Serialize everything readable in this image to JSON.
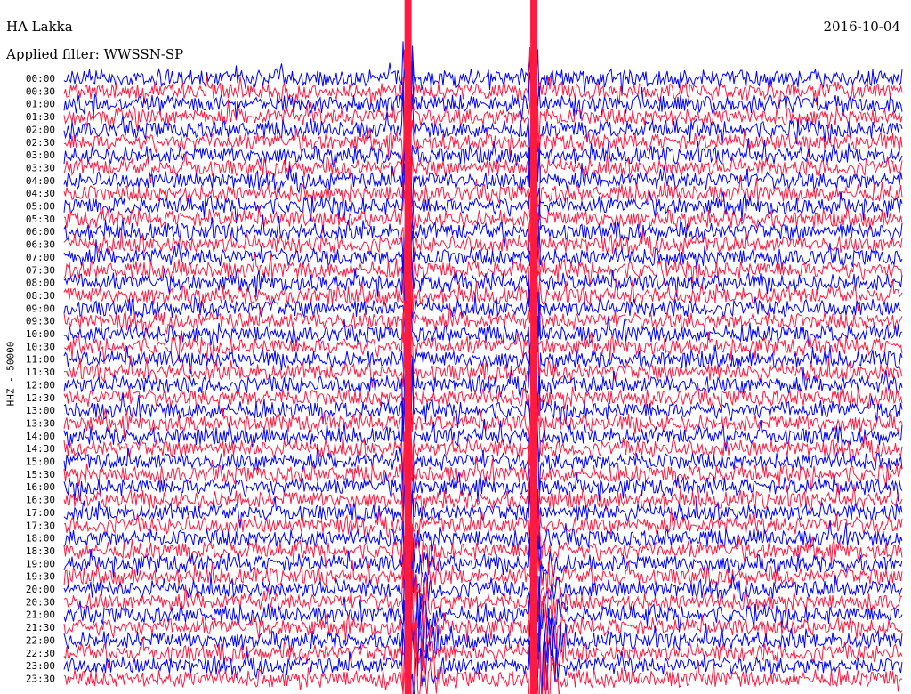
{
  "header": {
    "station": "HA Lakka",
    "date": "2016-10-04",
    "filter_label": "Applied filter: WWSSN-SP"
  },
  "chart_data": {
    "type": "line",
    "title": "HA Lakka",
    "subtitle": "Applied filter: WWSSN-SP",
    "ylabel": "HHZ - 50000",
    "xlabel": "",
    "row_labels": [
      "00:00",
      "00:30",
      "01:00",
      "01:30",
      "02:00",
      "02:30",
      "03:00",
      "03:30",
      "04:00",
      "04:30",
      "05:00",
      "05:30",
      "06:00",
      "06:30",
      "07:00",
      "07:30",
      "08:00",
      "08:30",
      "09:00",
      "09:30",
      "10:00",
      "10:30",
      "11:00",
      "11:30",
      "12:00",
      "12:30",
      "13:00",
      "13:30",
      "14:00",
      "14:30",
      "15:00",
      "15:30",
      "16:00",
      "16:30",
      "17:00",
      "17:30",
      "18:00",
      "18:30",
      "19:00",
      "19:30",
      "20:00",
      "20:30",
      "21:00",
      "21:30",
      "22:00",
      "22:30",
      "23:00",
      "23:30"
    ],
    "row_minutes": 30,
    "series_colors": [
      "#0000ff",
      "#ff1a40"
    ],
    "events": [
      {
        "row": "19:30",
        "fraction_of_row": 0.41,
        "note": "large signal spanning all traces"
      },
      {
        "row": "19:30",
        "fraction_of_row": 0.56,
        "note": "large signal spanning all traces"
      }
    ]
  }
}
